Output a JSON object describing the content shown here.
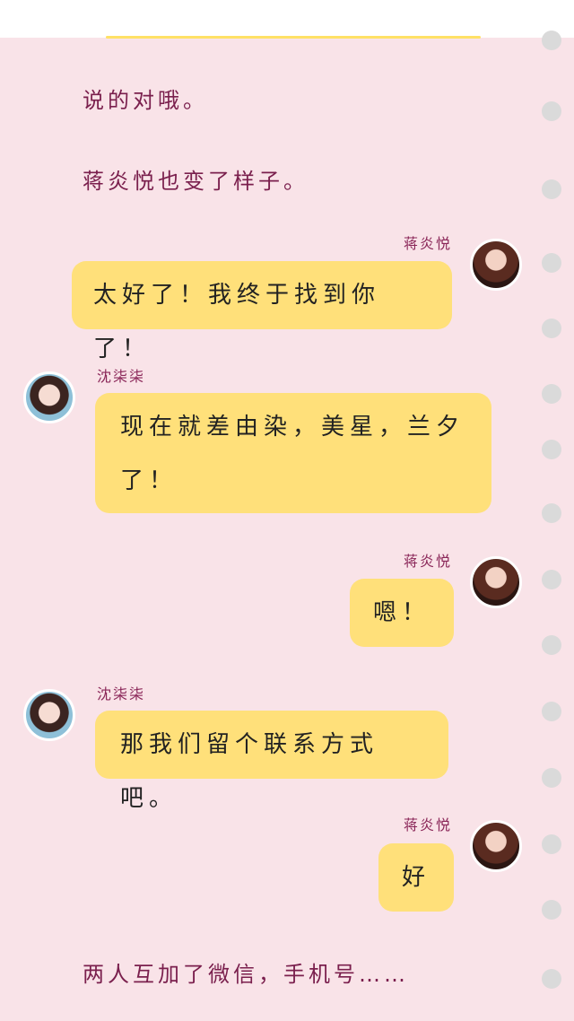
{
  "narration": [
    "说的对哦。",
    "蒋炎悦也变了样子。",
    "两人互加了微信，手机号……"
  ],
  "messages": [
    {
      "sender": "蒋炎悦",
      "text": "太好了！我终于找到你了！",
      "side": "right",
      "avatar": "avatar-jiang-yanyue"
    },
    {
      "sender": "沈柒柒",
      "text_line1": "现在就差由染，美星，兰夕",
      "text_line2": "了！",
      "side": "left",
      "avatar": "avatar-shen-qiqi"
    },
    {
      "sender": "蒋炎悦",
      "text": "嗯！",
      "side": "right",
      "avatar": "avatar-jiang-yanyue"
    },
    {
      "sender": "沈柒柒",
      "text": "那我们留个联系方式吧。",
      "side": "left",
      "avatar": "avatar-shen-qiqi"
    },
    {
      "sender": "蒋炎悦",
      "text": "好",
      "side": "right",
      "avatar": "avatar-jiang-yanyue"
    }
  ],
  "colors": {
    "background": "#f9e3e8",
    "bubble": "#ffe07a",
    "narration_text": "#7a1f4d",
    "sender_text": "#8a2658",
    "notebook_hole": "#dadada"
  }
}
